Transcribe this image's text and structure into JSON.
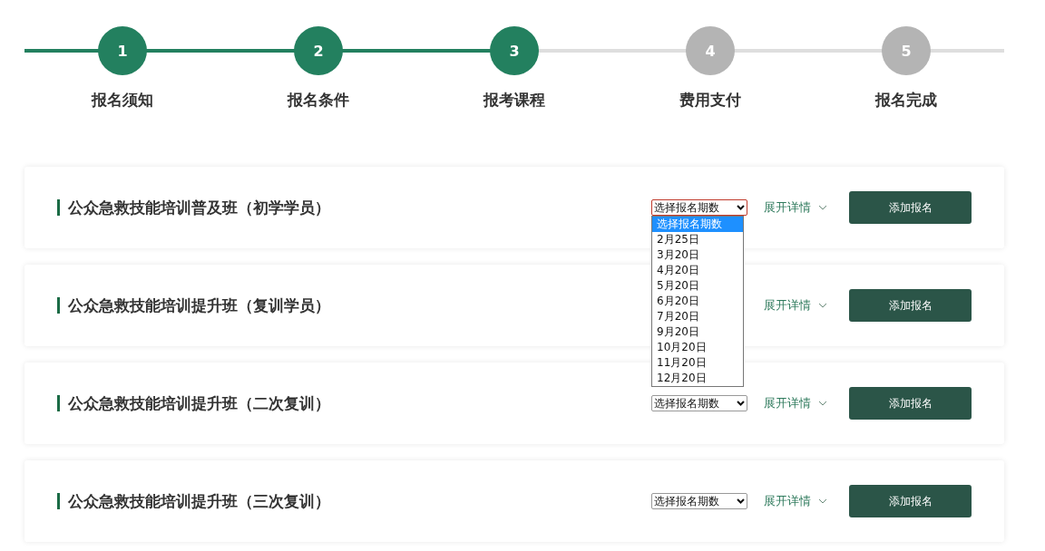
{
  "steps": [
    {
      "number": "1",
      "label": "报名须知",
      "completed": true
    },
    {
      "number": "2",
      "label": "报名条件",
      "completed": true
    },
    {
      "number": "3",
      "label": "报考课程",
      "completed": true
    },
    {
      "number": "4",
      "label": "费用支付",
      "completed": false
    },
    {
      "number": "5",
      "label": "报名完成",
      "completed": false
    }
  ],
  "courses": [
    {
      "title": "公众急救技能培训普及班（初学学员）",
      "select": {
        "value": "选择报名期数",
        "open": true,
        "options": [
          {
            "label": "选择报名期数",
            "selected": true
          },
          {
            "label": "2月25日",
            "selected": false
          },
          {
            "label": "3月20日",
            "selected": false
          },
          {
            "label": "4月20日",
            "selected": false
          },
          {
            "label": "5月20日",
            "selected": false
          },
          {
            "label": "6月20日",
            "selected": false
          },
          {
            "label": "7月20日",
            "selected": false
          },
          {
            "label": "9月20日",
            "selected": false
          },
          {
            "label": "10月20日",
            "selected": false
          },
          {
            "label": "11月20日",
            "selected": false
          },
          {
            "label": "12月20日",
            "selected": false
          }
        ]
      },
      "details_link": "展开详情",
      "add_button": "添加报名"
    },
    {
      "title": "公众急救技能培训提升班（复训学员）",
      "details_link": "展开详情",
      "add_button": "添加报名"
    },
    {
      "title": "公众急救技能培训提升班（二次复训）",
      "select": {
        "value": "选择报名期数",
        "open": false
      },
      "details_link": "展开详情",
      "add_button": "添加报名"
    },
    {
      "title": "公众急救技能培训提升班（三次复训）",
      "select": {
        "value": "选择报名期数",
        "open": false
      },
      "details_link": "展开详情",
      "add_button": "添加报名"
    }
  ]
}
